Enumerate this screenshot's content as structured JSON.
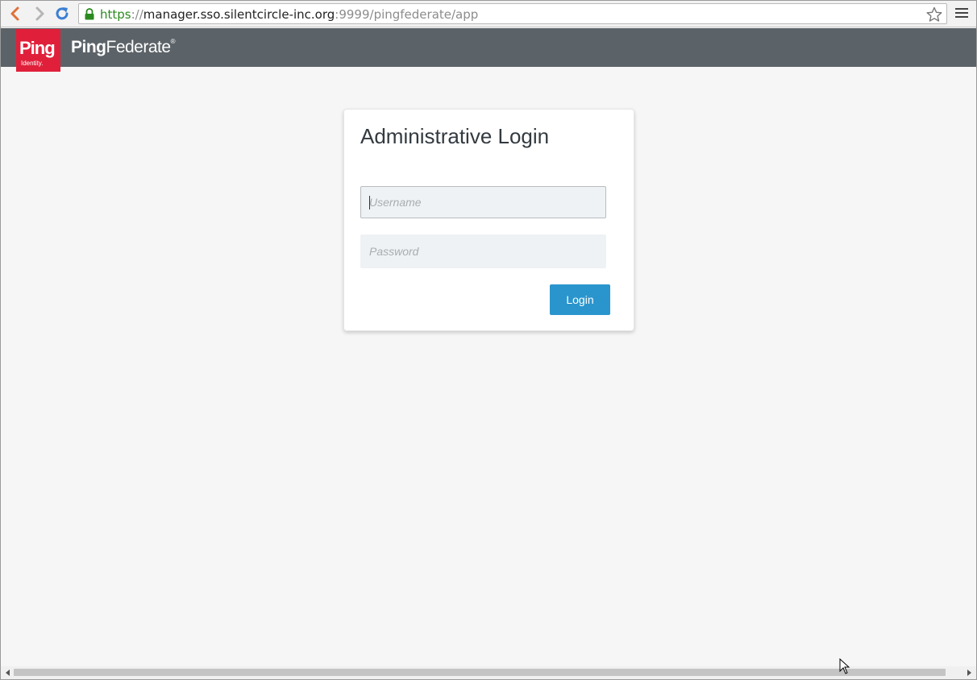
{
  "browser": {
    "url_scheme": "https",
    "url_separator": "://",
    "url_host": "manager.sso.silentcircle-inc.org",
    "url_rest": ":9999/pingfederate/app",
    "icons": [
      "back-icon",
      "forward-icon",
      "reload-icon",
      "lock-icon",
      "star-icon",
      "menu-icon"
    ]
  },
  "header": {
    "logo_big": "Ping",
    "logo_small": "Identity.",
    "product_bold": "Ping",
    "product_light": "Federate",
    "product_reg": "®",
    "background_color": "#5c6368",
    "logo_color": "#e0203a"
  },
  "login": {
    "title": "Administrative Login",
    "username_placeholder": "Username",
    "username_value": "",
    "password_placeholder": "Password",
    "password_value": "",
    "button_label": "Login",
    "button_color": "#2a95cd"
  }
}
